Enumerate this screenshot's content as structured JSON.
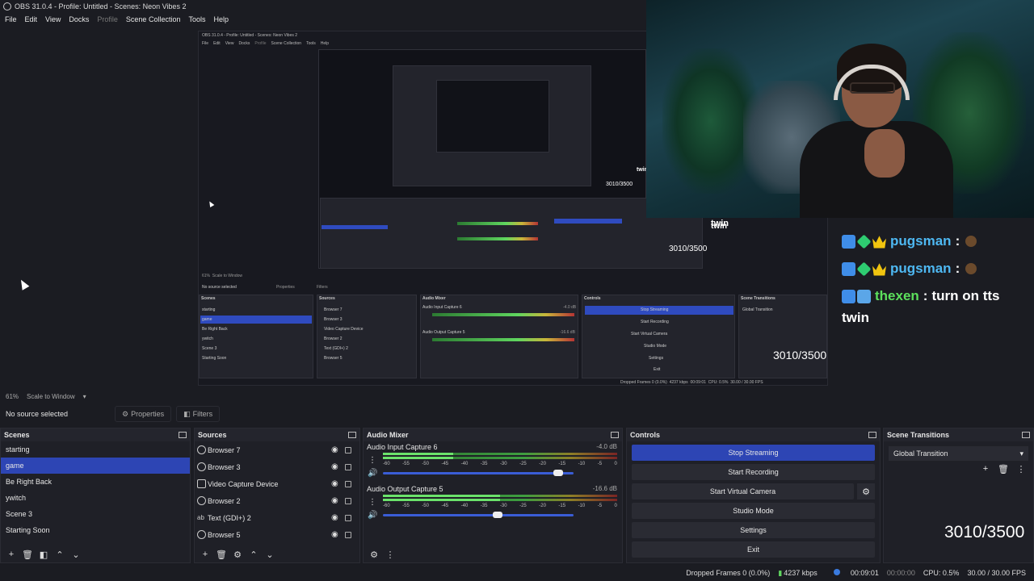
{
  "window": {
    "title": "OBS 31.0.4 - Profile: Untitled - Scenes: Neon Vibes 2"
  },
  "menu": [
    "File",
    "Edit",
    "View",
    "Docks",
    "Profile",
    "Scene Collection",
    "Tools",
    "Help"
  ],
  "preview": {
    "nested_title": "OBS 31.0.4 - Profile: Untitled - Scenes: Neon Vibes 2",
    "nested_menu": [
      "File",
      "Edit",
      "View",
      "Docks",
      "Profile",
      "Scene Collection",
      "Tools",
      "Help"
    ],
    "nested_twin": "twin",
    "nested_counter": "3010/3500",
    "inner_counter_a": "3010/3500",
    "inner_counter_b": "3010/3500",
    "inner_twin_a": "twin",
    "inner_zoom": "61%",
    "inner_scale": "Scale to Window",
    "inner_no_source": "No source selected",
    "inner_properties": "Properties",
    "inner_filters": "Filters",
    "inner_scenes_title": "Scenes",
    "inner_sources_title": "Sources",
    "inner_mixer_title": "Audio Mixer",
    "inner_controls_title": "Controls",
    "inner_transitions_title": "Scene Transitions",
    "inner_scenes": [
      "starting",
      "game",
      "Be Right Back",
      "ywitch",
      "Scene 3",
      "Starting Soon"
    ],
    "inner_sources": [
      "Browser 7",
      "Browser 3",
      "Video Capture Device",
      "Browser 2",
      "Text (GDI+) 2",
      "Browser 5"
    ],
    "inner_mix1": "Audio Input Capture 6",
    "inner_mix1_db": "-4.0 dB",
    "inner_mix2": "Audio Output Capture 5",
    "inner_mix2_db": "-16.6 dB",
    "inner_controls": [
      "Stop Streaming",
      "Start Recording",
      "Start Virtual Camera",
      "Studio Mode",
      "Settings",
      "Exit"
    ],
    "inner_transition": "Global Transition",
    "inner_status": "Dropped Frames 0 (0.0%)",
    "inner_kbps": "4237 kbps",
    "inner_time": "00:09:01",
    "inner_cpu": "CPU: 0.5%",
    "inner_fps": "30.00 / 30.00 FPS"
  },
  "overlay": {
    "twin_label": "twin",
    "counter": "3010/3500",
    "counter_main": "3010/3500",
    "chat": [
      {
        "user": "pugsman",
        "text": ""
      },
      {
        "user": "pugsman",
        "text": ""
      },
      {
        "user": "thexen",
        "text": "turn on tts"
      }
    ],
    "chat_wrap": "twin",
    "chat_sep": ":"
  },
  "zoombar": {
    "zoom": "61%",
    "scale": "Scale to Window"
  },
  "source_toolbar": {
    "no_source": "No source selected",
    "properties": "Properties",
    "filters": "Filters"
  },
  "scenes": {
    "title": "Scenes",
    "items": [
      "starting",
      "game",
      "Be Right Back",
      "ywitch",
      "Scene 3",
      "Starting Soon"
    ],
    "selected": "game"
  },
  "sources": {
    "title": "Sources",
    "items": [
      "Browser 7",
      "Browser 3",
      "Video Capture Device",
      "Browser 2",
      "Text (GDI+) 2",
      "Browser 5"
    ]
  },
  "mixer": {
    "title": "Audio Mixer",
    "ticks": [
      "-60",
      "-55",
      "-50",
      "-45",
      "-40",
      "-35",
      "-30",
      "-25",
      "-20",
      "-15",
      "-10",
      "-5",
      "0"
    ],
    "channels": [
      {
        "name": "Audio Input Capture 6",
        "db": "-4.0 dB",
        "level": 0.3,
        "volume": 0.92
      },
      {
        "name": "Audio Output Capture 5",
        "db": "-16.6 dB",
        "level": 0.5,
        "volume": 0.6
      }
    ]
  },
  "controls": {
    "title": "Controls",
    "stop_streaming": "Stop Streaming",
    "start_recording": "Start Recording",
    "start_virtual_camera": "Start Virtual Camera",
    "studio_mode": "Studio Mode",
    "settings": "Settings",
    "exit": "Exit"
  },
  "transitions": {
    "title": "Scene Transitions",
    "selected": "Global Transition"
  },
  "status": {
    "dropped_frames": "Dropped Frames 0 (0.0%)",
    "bitrate": "4237 kbps",
    "stream_time": "00:09:01",
    "rec_time": "00:00:00",
    "cpu": "CPU: 0.5%",
    "fps": "30.00 / 30.00 FPS"
  },
  "colors": {
    "accent": "#2d45b4",
    "background": "#1b1c22",
    "dock": "#1f2027"
  }
}
